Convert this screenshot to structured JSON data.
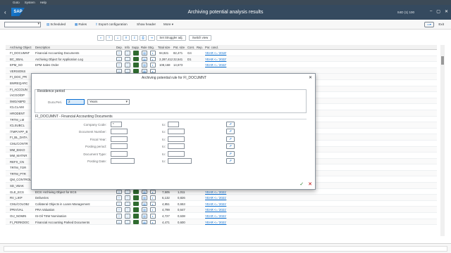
{
  "menubar": [
    "Goto",
    "System",
    "Help"
  ],
  "header": {
    "title": "Archiving potential analysis results",
    "system": "S4D (1) 100",
    "logo": "SAP"
  },
  "toolbar": {
    "scheduled": "Scheduled",
    "rules": "Rules",
    "export": "Export configuration",
    "show_header": "Show header",
    "more": "More",
    "exit": "Exit"
  },
  "alv": {
    "set_struggler": "Set Struggler adj.",
    "switch_view": "Switch view"
  },
  "columns": {
    "obj": "Archiving Object",
    "desc": "Description",
    "dep": "Dep.",
    "info": "Info",
    "supp": "Supp.",
    "rule": "Rule",
    "strg": "Strg.",
    "total": "Total size",
    "pot": "Pot. size",
    "cont": "Cont.",
    "rep": "Rep.",
    "por": "Por. cond."
  },
  "rows_top": [
    {
      "obj": "FI_DOCUMNT",
      "desc": "Financial Accounting Documents",
      "total": "94,821",
      "pot": "82,471",
      "cont": "G4",
      "por": "YEAR <= '2019'"
    },
    {
      "obj": "BC_SBAL",
      "desc": "Archiving Object for Application Log",
      "total": "2,287,412",
      "pot": "22,541",
      "cont": "D1",
      "por": "YEAR <= '2022'"
    },
    {
      "obj": "EPM_SO",
      "desc": "EPM Sales Order",
      "total": "108,168",
      "pot": "14,673",
      "cont": "",
      "por": "YEAR <= '2022'"
    },
    {
      "obj": "VERSIONS",
      "desc": "",
      "total": "",
      "pot": "",
      "cont": "",
      "por": ""
    }
  ],
  "rows_left": [
    "FI_DOC_PR",
    "BWREQARC",
    "FI_ACCOUN",
    "/ACGO/DP",
    "/IMG/ABPD",
    "ICLCLAIM",
    "HRODENT",
    "TRTM_LM",
    "ICLSUBCL",
    "/TMP/APP_B",
    "FI_BL_DATA",
    "CML/CONTR",
    "MM_EKKO",
    "MM_MATNR",
    "REFX_CN",
    "TRTM_TOR",
    "TRTM_PTR"
  ],
  "rows_bottom": [
    {
      "obj": "QM_CONTROL",
      "desc": "Inspection Lot Transaction Data",
      "total": "8,133",
      "pot": "1,096",
      "por": "YEAR <= '2021'"
    },
    {
      "obj": "SD_VBAK",
      "desc": "Sales Documents",
      "total": "7,991",
      "pot": "1,089",
      "por": "YEAR <= '2021'"
    },
    {
      "obj": "GLE_ECS",
      "desc": "ECS: Archiving Object for ECS",
      "total": "7,505",
      "pot": "1,011",
      "por": "YEAR <= '2021'"
    },
    {
      "obj": "RV_LIKP",
      "desc": "Deliveries",
      "total": "6,132",
      "pot": "0,826",
      "por": "YEAR <= '2021'"
    },
    {
      "obj": "CML/COLOBJ",
      "desc": "Collateral Objects in Loans Management",
      "total": "4,851",
      "pot": "0,653",
      "por": "YEAR <= '2021'"
    },
    {
      "obj": "/PRA/VAL",
      "desc": "PRA Valuation",
      "total": "4,799",
      "pot": "0,647",
      "por": "YEAR <= '2021'"
    },
    {
      "obj": "OIJ_NOMIN",
      "desc": "IS-Oil TSW Nomination",
      "total": "4,727",
      "pot": "0,638",
      "por": "YEAR <= '2021'"
    },
    {
      "obj": "FI_PERKDOC",
      "desc": "Financial Accounting Parked Documents",
      "total": "4,471",
      "pot": "0,600",
      "por": "YEAR <= '2021'"
    }
  ],
  "dialog": {
    "title": "Archiving potential rule for FI_DOCUMNT",
    "residence_group": "Residence period",
    "dur_label": "Dura.Peri.",
    "dur_value": "2",
    "unit_value": "Years",
    "section": "FI_DOCUMNT - Financial Accounting Documents",
    "fields": [
      {
        "label": "Company Code:",
        "value": "*"
      },
      {
        "label": "Document Number:",
        "value": ""
      },
      {
        "label": "Fiscal Year:",
        "value": ""
      },
      {
        "label": "Posting period:",
        "value": ""
      },
      {
        "label": "Document Type:",
        "value": ""
      },
      {
        "label": "Posting Date:",
        "value": ""
      }
    ],
    "to_label": "to:",
    "ok": "✓",
    "cancel": "✕"
  }
}
